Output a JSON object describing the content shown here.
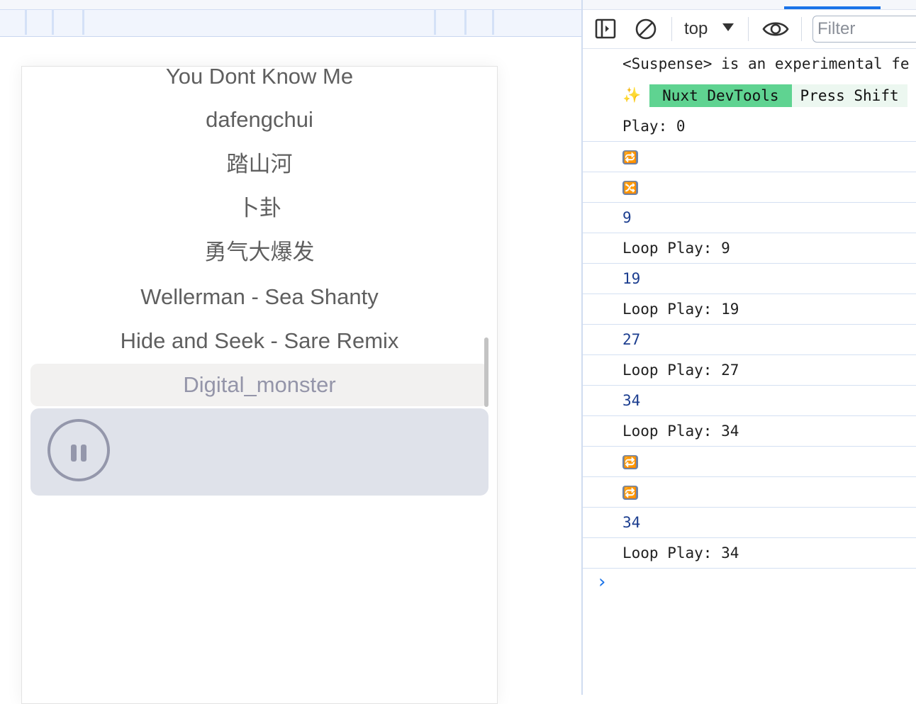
{
  "playlist": {
    "songs": [
      "You Dont Know Me",
      "dafengchui",
      "踏山河",
      "卜卦",
      "勇气大爆发",
      "Wellerman - Sea Shanty",
      "Hide and Seek - Sare Remix"
    ],
    "active_song": "Digital_monster"
  },
  "player": {
    "state": "playing",
    "control_icon": "pause-icon"
  },
  "devtools": {
    "toolbar": {
      "context": "top",
      "filter_placeholder": "Filter"
    },
    "console": {
      "suspense_warning": "<Suspense> is an experimental fe",
      "nuxt_badge": "Nuxt DevTools",
      "nuxt_hint": "Press Shift",
      "logs": [
        {
          "type": "text",
          "text": "Play: 0"
        },
        {
          "type": "emoji",
          "text": "🔁"
        },
        {
          "type": "emoji",
          "text": "🔀"
        },
        {
          "type": "number",
          "text": "9"
        },
        {
          "type": "text",
          "text": "Loop Play: 9"
        },
        {
          "type": "number",
          "text": "19"
        },
        {
          "type": "text",
          "text": "Loop Play: 19"
        },
        {
          "type": "number",
          "text": "27"
        },
        {
          "type": "text",
          "text": "Loop Play: 27"
        },
        {
          "type": "number",
          "text": "34"
        },
        {
          "type": "text",
          "text": "Loop Play: 34"
        },
        {
          "type": "emoji",
          "text": "🔁"
        },
        {
          "type": "emoji",
          "text": "🔁"
        },
        {
          "type": "number",
          "text": "34"
        },
        {
          "type": "text",
          "text": "Loop Play: 34"
        }
      ],
      "prompt": "›"
    }
  }
}
